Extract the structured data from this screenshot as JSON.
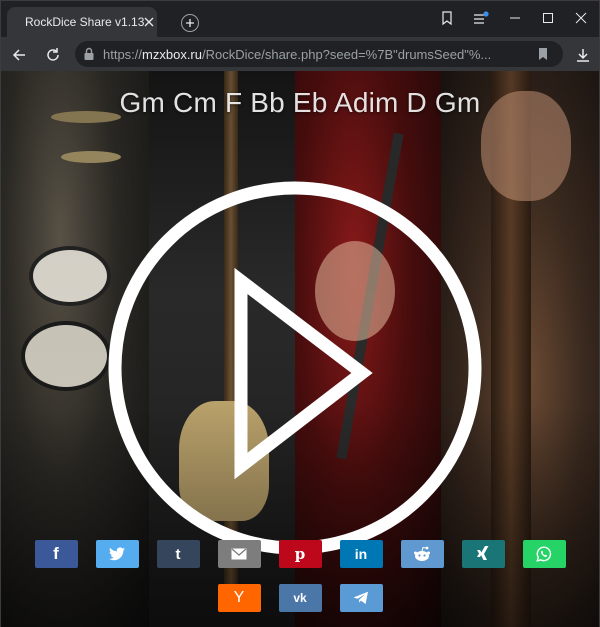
{
  "browser": {
    "tab_title": "RockDice Share v1.13",
    "url_prefix": "https://",
    "url_domain": "mzxbox.ru",
    "url_path": "/RockDice/share.php?seed=%7B\"drumsSeed\"%..."
  },
  "player": {
    "chords": "Gm Cm F Bb Eb Adim D Gm",
    "play_icon": "play-icon"
  },
  "share": {
    "row1": [
      {
        "name": "facebook",
        "color": "#3b5998",
        "glyph": "f"
      },
      {
        "name": "twitter",
        "color": "#55acee",
        "glyph": "twitter"
      },
      {
        "name": "tumblr",
        "color": "#35465c",
        "glyph": "t"
      },
      {
        "name": "email",
        "color": "#7d7d7d",
        "glyph": "mail"
      },
      {
        "name": "pinterest",
        "color": "#bd081c",
        "glyph": "p"
      },
      {
        "name": "linkedin",
        "color": "#0077b5",
        "glyph": "in"
      },
      {
        "name": "reddit",
        "color": "#5f99cf",
        "glyph": "reddit"
      },
      {
        "name": "xing",
        "color": "#1a7576",
        "glyph": "xing"
      },
      {
        "name": "whatsapp",
        "color": "#25d366",
        "glyph": "whatsapp"
      }
    ],
    "row2": [
      {
        "name": "yandex",
        "color": "#ff6600",
        "glyph": "Y"
      },
      {
        "name": "vk",
        "color": "#4a76a8",
        "glyph": "vk"
      },
      {
        "name": "telegram",
        "color": "#5b9bd5",
        "glyph": "telegram"
      }
    ]
  }
}
